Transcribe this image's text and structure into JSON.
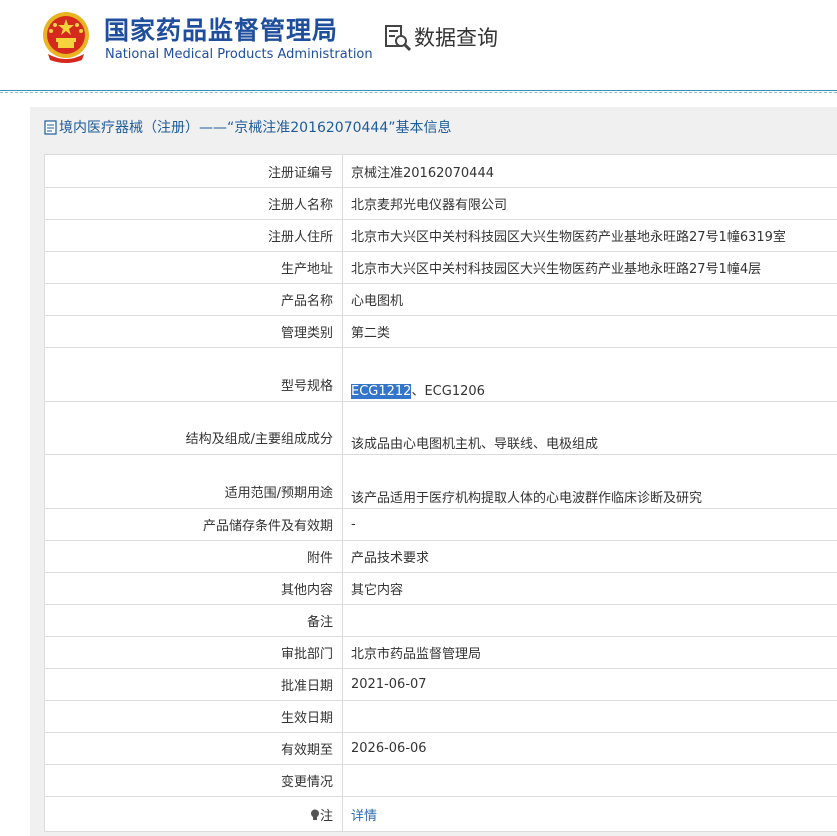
{
  "header": {
    "title_cn": "国家药品监督管理局",
    "title_en": "National Medical Products Administration",
    "query_label": "数据查询",
    "emblem_icon": "national-emblem",
    "query_icon": "document-search-icon",
    "brand_color": "#1f4e9c"
  },
  "panel": {
    "heading": "境内医疗器械（注册）——“京械注准20162070444”基本信息",
    "heading_icon": "document-icon"
  },
  "rows": [
    {
      "label": "注册证编号",
      "value": "京械注准20162070444"
    },
    {
      "label": "注册人名称",
      "value": "北京麦邦光电仪器有限公司"
    },
    {
      "label": "注册人住所",
      "value": "北京市大兴区中关村科技园区大兴生物医药产业基地永旺路27号1幢6319室"
    },
    {
      "label": "生产地址",
      "value": "北京市大兴区中关村科技园区大兴生物医药产业基地永旺路27号1幢4层"
    },
    {
      "label": "产品名称",
      "value": "心电图机"
    },
    {
      "label": "管理类别",
      "value": "第二类"
    },
    {
      "label": "型号规格",
      "value_selected": "ECG1212",
      "value_rest": "、ECG1206"
    },
    {
      "label": "结构及组成/主要组成成分",
      "value": "该成品由心电图机主机、导联线、电极组成"
    },
    {
      "label": "适用范围/预期用途",
      "value": "该产品适用于医疗机构提取人体的心电波群作临床诊断及研究"
    },
    {
      "label": "产品储存条件及有效期",
      "value": "-"
    },
    {
      "label": "附件",
      "value": "产品技术要求"
    },
    {
      "label": "其他内容",
      "value": "其它内容"
    },
    {
      "label": "备注",
      "value": ""
    },
    {
      "label": "审批部门",
      "value": "北京市药品监督管理局"
    },
    {
      "label": "批准日期",
      "value": "2021-06-07"
    },
    {
      "label": "生效日期",
      "value": ""
    },
    {
      "label": "有效期至",
      "value": "2026-06-06"
    },
    {
      "label": "变更情况",
      "value": ""
    },
    {
      "label": "注",
      "value": "详情",
      "icon": "lightbulb-icon"
    }
  ]
}
